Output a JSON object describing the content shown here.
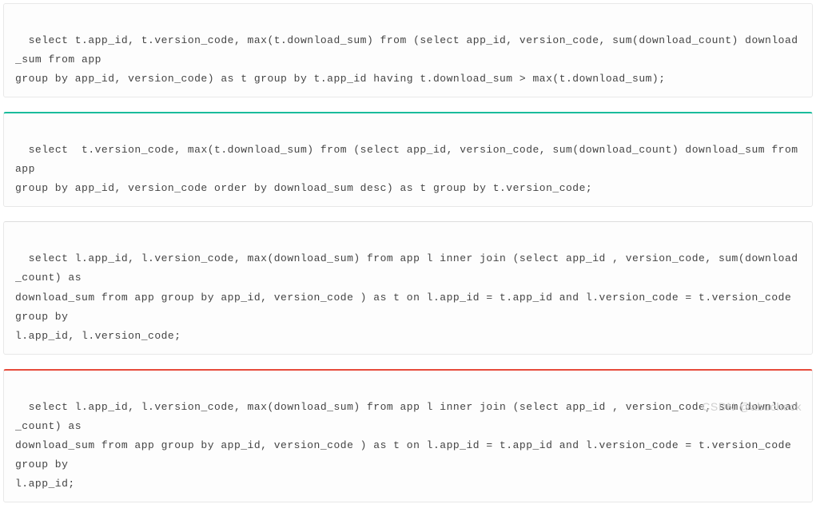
{
  "blocks": [
    {
      "style": "plain",
      "code": "select t.app_id, t.version_code, max(t.download_sum) from (select app_id, version_code, sum(download_count) download_sum from app\ngroup by app_id, version_code) as t group by t.app_id having t.download_sum > max(t.download_sum);"
    },
    {
      "style": "teal",
      "code": "select  t.version_code, max(t.download_sum) from (select app_id, version_code, sum(download_count) download_sum from app\ngroup by app_id, version_code order by download_sum desc) as t group by t.version_code;"
    },
    {
      "style": "gray",
      "code": "select l.app_id, l.version_code, max(download_sum) from app l inner join (select app_id , version_code, sum(download_count) as\ndownload_sum from app group by app_id, version_code ) as t on l.app_id = t.app_id and l.version_code = t.version_code group by\nl.app_id, l.version_code;"
    },
    {
      "style": "red",
      "code": "select l.app_id, l.version_code, max(download_sum) from app l inner join (select app_id , version_code, sum(download_count) as\ndownload_sum from app group by app_id, version_code ) as t on l.app_id = t.app_id and l.version_code = t.version_code group by\nl.app_id;"
    }
  ],
  "watermark": "CSDN @abucheck"
}
